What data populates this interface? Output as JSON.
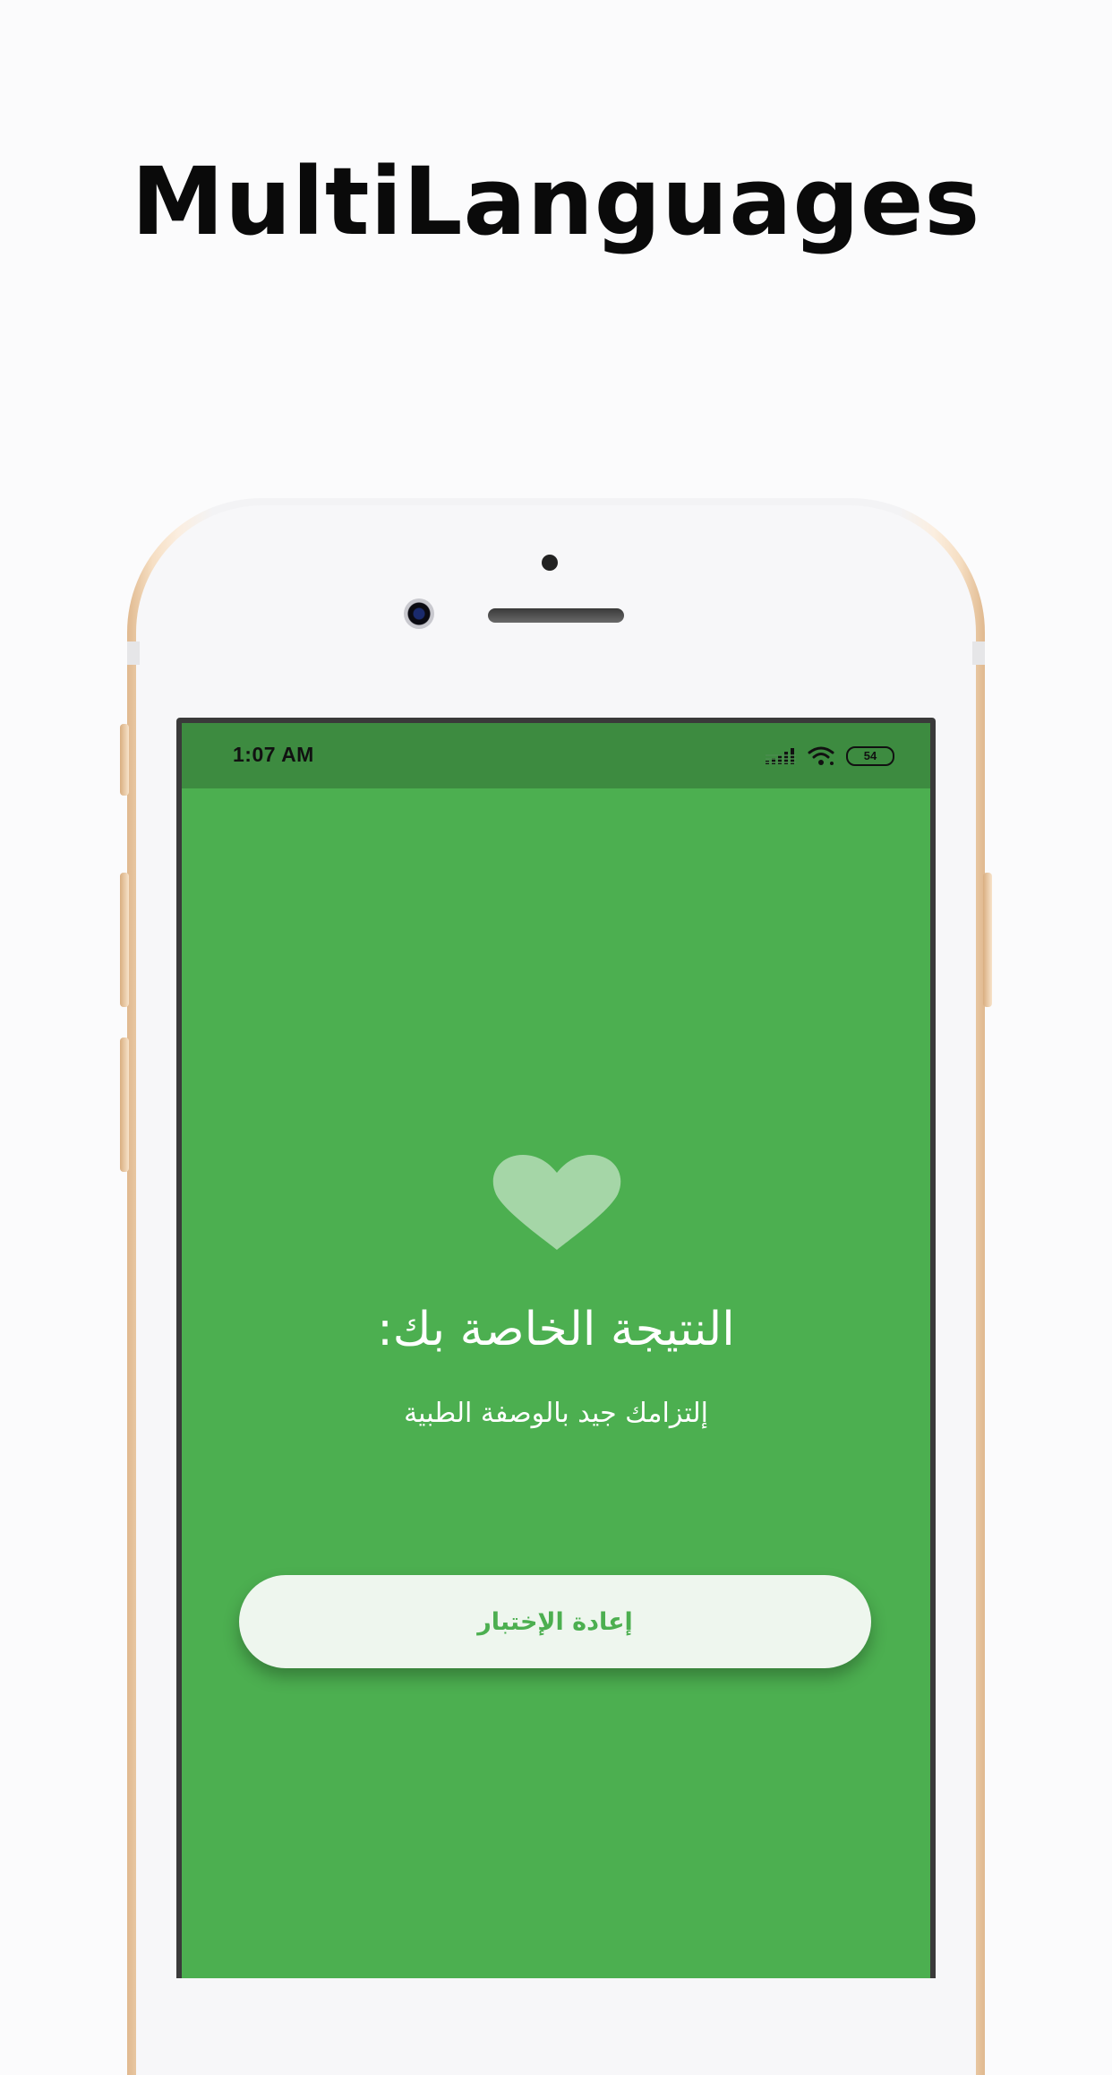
{
  "promo": {
    "title": "MultiLanguages"
  },
  "status_bar": {
    "time": "1:07 AM",
    "battery": "54",
    "icons": [
      "signal-icon",
      "wifi-icon",
      "battery-icon"
    ]
  },
  "result_screen": {
    "icon": "heart-icon",
    "heading": "النتيجة الخاصة بك:",
    "message": "إلتزامك جيد بالوصفة الطبية",
    "retest_button_label": "إعادة الإختبار"
  },
  "colors": {
    "background": "#4caf50",
    "status_bar": "#3d8b40",
    "heart": "#a5d6a7",
    "button_background": "#eef6ee",
    "button_text": "#4caf50"
  }
}
